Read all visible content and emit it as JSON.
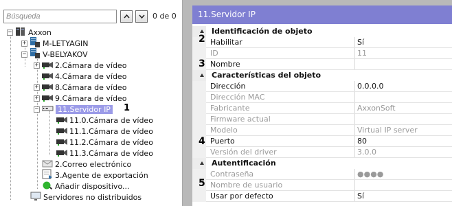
{
  "search": {
    "placeholder": "Búsqueda",
    "counter": "0 de 0"
  },
  "tree": {
    "root": "Axxon",
    "items": [
      {
        "label": "M-LETYAGIN"
      },
      {
        "label": "V-BELYAKOV"
      },
      {
        "label": "2.Cámara de vídeo"
      },
      {
        "label": "4.Cámara de vídeo"
      },
      {
        "label": "8.Cámara de vídeo"
      },
      {
        "label": "9.Cámara de vídeo"
      },
      {
        "label": "11.Servidor IP"
      },
      {
        "label": "11.0.Cámara de vídeo"
      },
      {
        "label": "11.1.Cámara de vídeo"
      },
      {
        "label": "11.2.Cámara de vídeo"
      },
      {
        "label": "11.3.Cámara de vídeo"
      },
      {
        "label": "2.Correo electrónico"
      },
      {
        "label": "3.Agente de exportación"
      },
      {
        "label": "Añadir dispositivo..."
      },
      {
        "label": "Servidores no distribuidos"
      }
    ],
    "callout": "1"
  },
  "panel": {
    "title": "11.Servidor IP",
    "sections": {
      "ident": "Identificación de objeto",
      "chars": "Características del objeto",
      "auth": "Autentificación"
    },
    "props": {
      "habilitar": {
        "k": "Habilitar",
        "v": "Sí"
      },
      "id": {
        "k": "ID",
        "v": "11"
      },
      "nombre": {
        "k": "Nombre",
        "v": ""
      },
      "direccion": {
        "k": "Dirección",
        "v": "0.0.0.0"
      },
      "mac": {
        "k": "Dirección MAC",
        "v": ""
      },
      "fabricante": {
        "k": "Fabricante",
        "v": "AxxonSoft"
      },
      "firmware": {
        "k": "Firmware actual",
        "v": ""
      },
      "modelo": {
        "k": "Modelo",
        "v": "Virtual IP server"
      },
      "puerto": {
        "k": "Puerto",
        "v": "80"
      },
      "driver": {
        "k": "Versión del driver",
        "v": "3.0.0"
      },
      "contrasena": {
        "k": "Contraseña",
        "v": "●●●●"
      },
      "usuario": {
        "k": "Nombre de usuario",
        "v": ""
      },
      "defecto": {
        "k": "Usar por defecto",
        "v": "Sí"
      }
    },
    "callouts": {
      "c2": "2",
      "c3": "3",
      "c4": "4",
      "c5": "5"
    }
  },
  "colors": {
    "header": "#7f7fd2",
    "selection": "#9b9be8",
    "background": "#b9b9b9"
  }
}
